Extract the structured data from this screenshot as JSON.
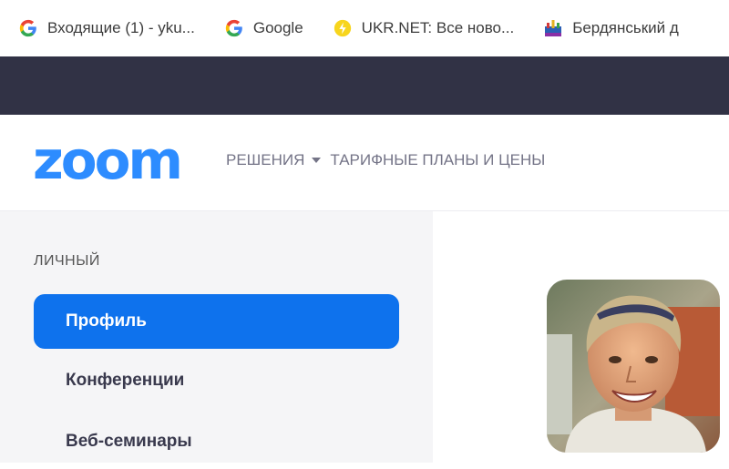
{
  "bookmarks": [
    {
      "icon": "google-g-icon",
      "label": "Входящие (1) - yku..."
    },
    {
      "icon": "google-g-icon",
      "label": "Google"
    },
    {
      "icon": "ukrnet-icon",
      "label": "UKR.NET: Все ново..."
    },
    {
      "icon": "city-crest-icon",
      "label": "Бердянський д"
    }
  ],
  "header": {
    "logo": "zoom",
    "nav": {
      "solutions": "РЕШЕНИЯ",
      "pricing": "ТАРИФНЫЕ ПЛАНЫ И ЦЕНЫ"
    }
  },
  "sidebar": {
    "section_title": "ЛИЧНЫЙ",
    "items": [
      {
        "label": "Профиль",
        "active": true
      },
      {
        "label": "Конференции",
        "active": false
      },
      {
        "label": "Веб-семинары",
        "active": false
      }
    ]
  },
  "colors": {
    "brand": "#2d8cff",
    "active_item": "#0e72ed",
    "dark_band": "#313245",
    "sidebar_bg": "#f5f5f7"
  }
}
